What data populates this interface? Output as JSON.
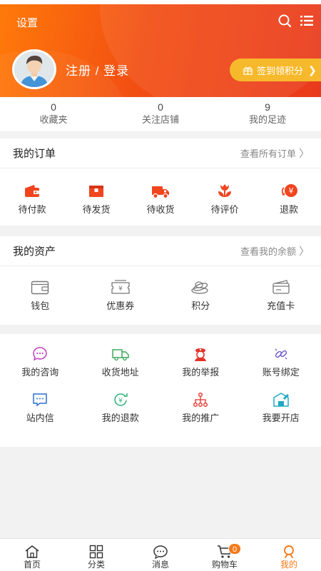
{
  "header": {
    "settings_label": "设置",
    "login_label": "注册 / 登录",
    "signin_label": "签到领积分",
    "accent_color": "#f24e13",
    "signin_color": "#f7b92c",
    "search_icon": "search-icon",
    "menu_icon": "list-menu-icon"
  },
  "stats": [
    {
      "value": "0",
      "label": "收藏夹"
    },
    {
      "value": "0",
      "label": "关注店铺"
    },
    {
      "value": "9",
      "label": "我的足迹"
    }
  ],
  "orders": {
    "title": "我的订单",
    "link": "查看所有订单",
    "items": [
      {
        "label": "待付款",
        "icon": "wallet-icon"
      },
      {
        "label": "待发货",
        "icon": "package-icon"
      },
      {
        "label": "待收货",
        "icon": "truck-icon"
      },
      {
        "label": "待评价",
        "icon": "flower-icon"
      },
      {
        "label": "退款",
        "icon": "refund-icon"
      }
    ]
  },
  "assets": {
    "title": "我的资产",
    "link": "查看我的余额",
    "items": [
      {
        "label": "钱包",
        "icon": "wallet-outline-icon"
      },
      {
        "label": "优惠券",
        "icon": "coupon-icon"
      },
      {
        "label": "积分",
        "icon": "coins-icon"
      },
      {
        "label": "充值卡",
        "icon": "card-icon"
      }
    ]
  },
  "services": {
    "row1": [
      {
        "label": "我的咨询",
        "icon": "chat-icon"
      },
      {
        "label": "收货地址",
        "icon": "delivery-truck-icon"
      },
      {
        "label": "我的举报",
        "icon": "police-icon"
      },
      {
        "label": "账号绑定",
        "icon": "link-icon"
      }
    ],
    "row2": [
      {
        "label": "站内信",
        "icon": "message-icon"
      },
      {
        "label": "我的退款",
        "icon": "yuan-refund-icon"
      },
      {
        "label": "我的推广",
        "icon": "share-tree-icon"
      },
      {
        "label": "我要开店",
        "icon": "shop-icon"
      }
    ]
  },
  "tabbar": {
    "tabs": [
      {
        "label": "首页",
        "icon": "home-icon"
      },
      {
        "label": "分类",
        "icon": "grid-icon"
      },
      {
        "label": "消息",
        "icon": "message-bubble-icon"
      },
      {
        "label": "购物车",
        "icon": "cart-icon",
        "badge": "0"
      },
      {
        "label": "我的",
        "icon": "profile-icon",
        "active": true
      }
    ],
    "active_color": "#f57a18"
  }
}
